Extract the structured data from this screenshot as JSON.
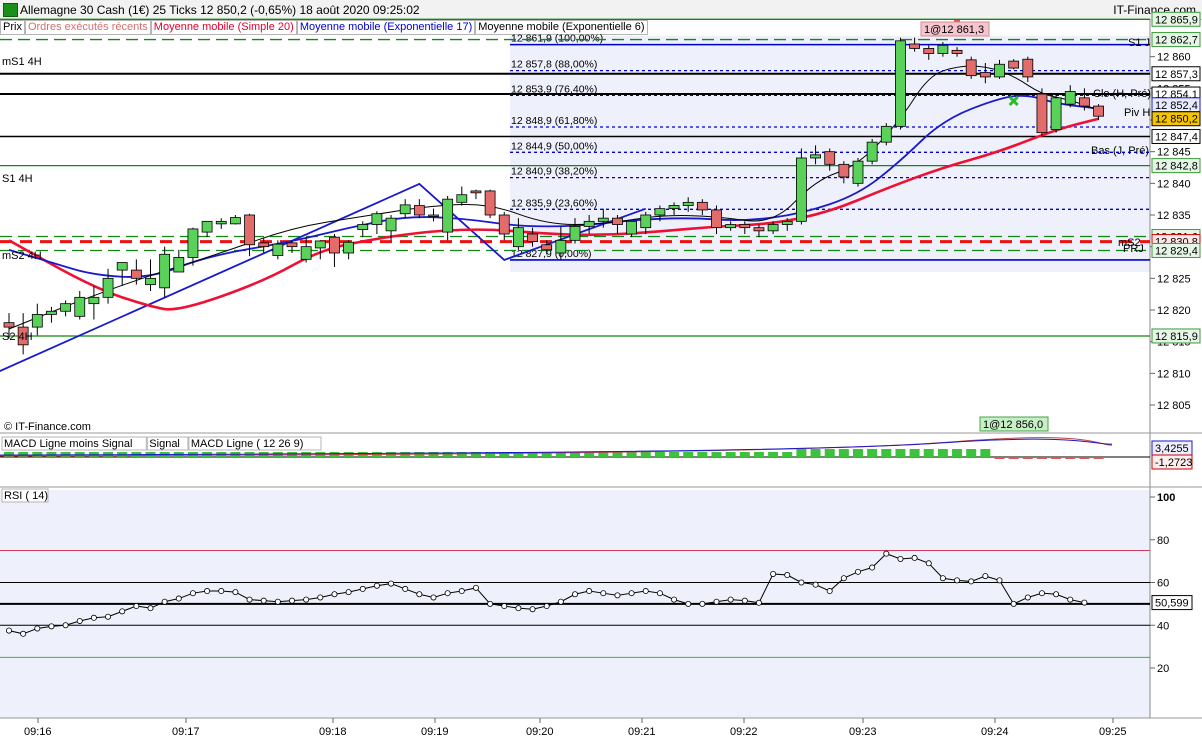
{
  "header": {
    "title": "Allemagne 30 Cash (1€)   25 Ticks   12 850,2 (-0,65%)   18 août 2020 09:25:02",
    "brand": "IT-Finance.com"
  },
  "legend": {
    "prix": "Prix",
    "ordres": "Ordres exécutés récents",
    "sma20": "Moyenne mobile (Simple 20)",
    "ema17": "Moyenne mobile (Exponentielle 17)",
    "ema6": "Moyenne mobile (Exponentielle 6)"
  },
  "watermark": "© IT-Finance.com",
  "colors": {
    "up": "#5ad25a",
    "down": "#e26b6b",
    "sma20": "#ee1133",
    "ema17": "#1a1acc",
    "ema6": "#000000",
    "pivot_green": "#118811",
    "fib_blue": "#0000cc",
    "macd_hist": "#3cc23c",
    "rsi_line": "#000000"
  },
  "chart_data": [
    {
      "type": "candlestick",
      "panel": "price",
      "ylim": [
        12799,
        12871
      ],
      "yticks": [
        12805,
        12810,
        12815,
        12820,
        12825,
        12830,
        12835,
        12840,
        12845,
        12850,
        12855,
        12860
      ],
      "xlabels": [
        "09:16",
        "09:17",
        "09:18",
        "09:19",
        "09:20",
        "09:21",
        "09:22",
        "09:23",
        "09:24",
        "09:25"
      ],
      "candles": [
        [
          12818.0,
          12819.5,
          12815.5,
          12817.3
        ],
        [
          12817.3,
          12819.5,
          12813.0,
          12814.5
        ],
        [
          12817.3,
          12821.0,
          12816.0,
          12819.3
        ],
        [
          12819.3,
          12820.5,
          12818.0,
          12819.8
        ],
        [
          12819.8,
          12821.5,
          12819.0,
          12821.0
        ],
        [
          12819.0,
          12823.0,
          12818.5,
          12822.0
        ],
        [
          12821.0,
          12823.8,
          12818.5,
          12822.0
        ],
        [
          12822.0,
          12826.5,
          12821.0,
          12825.0
        ],
        [
          12826.3,
          12827.0,
          12823.8,
          12827.5
        ],
        [
          12826.3,
          12828.0,
          12824.0,
          12825.0
        ],
        [
          12824.0,
          12828.0,
          12823.0,
          12825.0
        ],
        [
          12823.5,
          12830.0,
          12822.0,
          12828.8
        ],
        [
          12826.0,
          12829.5,
          12826.0,
          12828.3
        ],
        [
          12828.3,
          12833.0,
          12827.0,
          12832.8
        ],
        [
          12832.3,
          12834.0,
          12831.5,
          12834.0
        ],
        [
          12833.6,
          12834.5,
          12832.8,
          12834.0
        ],
        [
          12833.6,
          12835.0,
          12833.5,
          12834.6
        ],
        [
          12835.0,
          12835.2,
          12828.5,
          12830.3
        ],
        [
          12830.6,
          12831.3,
          12829.0,
          12830.0
        ],
        [
          12828.6,
          12831.0,
          12828.0,
          12830.4
        ],
        [
          12830.6,
          12831.0,
          12829.0,
          12830.0
        ],
        [
          12828.0,
          12831.5,
          12827.5,
          12830.0
        ],
        [
          12829.8,
          12831.0,
          12828.0,
          12830.9
        ],
        [
          12831.5,
          12832.0,
          12826.8,
          12829.0
        ],
        [
          12829.0,
          12831.0,
          12828.0,
          12830.7
        ],
        [
          12832.7,
          12834.0,
          12831.5,
          12833.5
        ],
        [
          12833.5,
          12835.6,
          12832.0,
          12835.2
        ],
        [
          12832.5,
          12835.0,
          12831.0,
          12834.5
        ],
        [
          12835.2,
          12837.5,
          12834.5,
          12836.6
        ],
        [
          12836.5,
          12837.5,
          12834.5,
          12835.0
        ],
        [
          12835.0,
          12836.0,
          12834.0,
          12835.0
        ],
        [
          12832.3,
          12838.0,
          12831.0,
          12837.5
        ],
        [
          12837.0,
          12839.5,
          12836.5,
          12838.2
        ],
        [
          12838.8,
          12839.0,
          12837.5,
          12838.5
        ],
        [
          12838.8,
          12839.0,
          12834.5,
          12835.0
        ],
        [
          12835.0,
          12835.5,
          12831.0,
          12832.0
        ],
        [
          12830.0,
          12834.5,
          12829.5,
          12833.0
        ],
        [
          12832.0,
          12833.0,
          12830.0,
          12830.8
        ],
        [
          12830.3,
          12831.0,
          12828.8,
          12829.5
        ],
        [
          12829.0,
          12833.2,
          12828.0,
          12831.0
        ],
        [
          12831.0,
          12834.5,
          12830.5,
          12833.2
        ],
        [
          12833.2,
          12835.0,
          12832.0,
          12834.0
        ],
        [
          12834.0,
          12836.0,
          12833.0,
          12834.5
        ],
        [
          12834.5,
          12835.0,
          12832.0,
          12833.5
        ],
        [
          12832.0,
          12834.0,
          12831.5,
          12834.0
        ],
        [
          12833.0,
          12835.5,
          12832.0,
          12835.0
        ],
        [
          12835.0,
          12836.5,
          12834.0,
          12836.0
        ],
        [
          12836.0,
          12837.0,
          12835.0,
          12836.5
        ],
        [
          12836.5,
          12837.8,
          12835.5,
          12837.0
        ],
        [
          12837.0,
          12837.5,
          12835.0,
          12835.8
        ],
        [
          12835.8,
          12836.5,
          12832.0,
          12833.0
        ],
        [
          12833.0,
          12834.0,
          12832.5,
          12833.5
        ],
        [
          12833.5,
          12834.0,
          12832.0,
          12833.0
        ],
        [
          12833.0,
          12833.5,
          12831.5,
          12832.5
        ],
        [
          12832.5,
          12834.0,
          12832.0,
          12833.5
        ],
        [
          12833.5,
          12834.5,
          12832.5,
          12834.0
        ],
        [
          12834.0,
          12845.5,
          12833.5,
          12844.0
        ],
        [
          12844.0,
          12846.0,
          12843.0,
          12844.5
        ],
        [
          12845.0,
          12845.5,
          12842.0,
          12843.0
        ],
        [
          12843.0,
          12843.5,
          12840.0,
          12841.0
        ],
        [
          12840.0,
          12844.0,
          12839.5,
          12843.5
        ],
        [
          12843.5,
          12847.0,
          12843.0,
          12846.5
        ],
        [
          12846.5,
          12849.5,
          12846.0,
          12849.0
        ],
        [
          12849.0,
          12863.0,
          12848.5,
          12862.5
        ],
        [
          12862.0,
          12863.0,
          12860.8,
          12861.3
        ],
        [
          12861.3,
          12861.8,
          12859.5,
          12860.5
        ],
        [
          12860.5,
          12862.3,
          12860.0,
          12861.8
        ],
        [
          12861.0,
          12861.5,
          12860.0,
          12860.5
        ],
        [
          12859.5,
          12860.0,
          12856.5,
          12857.0
        ],
        [
          12857.5,
          12859.0,
          12855.8,
          12856.8
        ],
        [
          12856.8,
          12859.5,
          12856.5,
          12858.8
        ],
        [
          12859.3,
          12859.6,
          12858.0,
          12858.2
        ],
        [
          12859.6,
          12860.0,
          12856.0,
          12856.8
        ],
        [
          12854.1,
          12855.0,
          12847.5,
          12848.0
        ],
        [
          12848.5,
          12854.0,
          12848.0,
          12853.5
        ],
        [
          12852.5,
          12855.5,
          12852.0,
          12854.5
        ],
        [
          12853.5,
          12855.0,
          12851.5,
          12852.2
        ],
        [
          12852.2,
          12852.5,
          12850.0,
          12850.6
        ]
      ],
      "sma20": [
        [
          0,
          12831.0
        ],
        [
          6,
          12823.5
        ],
        [
          10,
          12820.5
        ],
        [
          12,
          12819.8
        ],
        [
          18,
          12824.5
        ],
        [
          22,
          12829.5
        ],
        [
          26,
          12831.3
        ],
        [
          30,
          12832.5
        ],
        [
          34,
          12832.8
        ],
        [
          38,
          12832.0
        ],
        [
          42,
          12831.8
        ],
        [
          46,
          12832.4
        ],
        [
          50,
          12833.2
        ],
        [
          54,
          12833.6
        ],
        [
          58,
          12835.5
        ],
        [
          62,
          12839.2
        ],
        [
          66,
          12842.5
        ],
        [
          70,
          12845.0
        ],
        [
          74,
          12848.5
        ],
        [
          77,
          12850.2
        ]
      ],
      "ema17": [
        [
          0,
          12829.5
        ],
        [
          3,
          12827.5
        ],
        [
          6,
          12825.5
        ],
        [
          10,
          12825.0
        ],
        [
          14,
          12828.5
        ],
        [
          20,
          12830.8
        ],
        [
          24,
          12833.0
        ],
        [
          28,
          12834.8
        ],
        [
          32,
          12834.5
        ],
        [
          36,
          12833.2
        ],
        [
          40,
          12833.2
        ],
        [
          44,
          12834.2
        ],
        [
          48,
          12834.6
        ],
        [
          52,
          12834.0
        ],
        [
          56,
          12835.2
        ],
        [
          60,
          12838.2
        ],
        [
          63,
          12843.5
        ],
        [
          66,
          12850.0
        ],
        [
          70,
          12853.5
        ],
        [
          72,
          12854.0
        ],
        [
          74,
          12852.6
        ],
        [
          77,
          12851.8
        ]
      ],
      "ema6": [
        [
          0,
          12817.0
        ],
        [
          5,
          12821.5
        ],
        [
          10,
          12825.5
        ],
        [
          15,
          12829.0
        ],
        [
          20,
          12833.0
        ],
        [
          25,
          12834.8
        ],
        [
          30,
          12836.5
        ],
        [
          34,
          12836.8
        ],
        [
          38,
          12833.5
        ],
        [
          42,
          12833.5
        ],
        [
          46,
          12835.0
        ],
        [
          50,
          12834.8
        ],
        [
          54,
          12833.5
        ],
        [
          57,
          12840.5
        ],
        [
          60,
          12842.8
        ],
        [
          63,
          12850.0
        ],
        [
          65,
          12857.0
        ],
        [
          67,
          12858.5
        ],
        [
          69,
          12858.5
        ],
        [
          71,
          12857.0
        ],
        [
          73,
          12854.0
        ],
        [
          75,
          12853.2
        ],
        [
          77,
          12851.5
        ]
      ],
      "zigzag": [
        [
          -1,
          12810.0
        ],
        [
          29,
          12839.9
        ],
        [
          35,
          12827.9
        ],
        [
          45,
          12836.0
        ]
      ],
      "fib_levels": [
        {
          "label": "12 861,9 (100,00%)",
          "value": 12861.9
        },
        {
          "label": "12 857,8 (88,00%)",
          "value": 12857.8
        },
        {
          "label": "12 853,9 (76,40%)",
          "value": 12853.9
        },
        {
          "label": "12 848,9 (61,80%)",
          "value": 12848.9
        },
        {
          "label": "12 844,9 (50,00%)",
          "value": 12844.9
        },
        {
          "label": "12 840,9 (38,20%)",
          "value": 12840.9
        },
        {
          "label": "12 835,9 (23,60%)",
          "value": 12835.9
        },
        {
          "label": "12 827,9 (0,00%)",
          "value": 12827.9
        }
      ],
      "fib_top_dotted": 12869.6,
      "price_labels": [
        {
          "value": 12865.9,
          "label": "12 865,9",
          "kind": "green"
        },
        {
          "value": 12862.7,
          "label": "12 862,7",
          "kind": "green"
        },
        {
          "value": 12857.3,
          "label": "12 857,3",
          "kind": "black"
        },
        {
          "value": 12854.1,
          "label": "12 854,1",
          "kind": "black"
        },
        {
          "value": 12852.4,
          "label": "12 852,4",
          "kind": "blue"
        },
        {
          "value": 12850.2,
          "label": "12 850,2",
          "kind": "current"
        },
        {
          "value": 12847.4,
          "label": "12 847,4",
          "kind": "black"
        },
        {
          "value": 12842.8,
          "label": "12 842,8",
          "kind": "green"
        },
        {
          "value": 12831.6,
          "label": "12 831,6",
          "kind": "green"
        },
        {
          "value": 12830.8,
          "label": "12 830,8",
          "kind": "red"
        },
        {
          "value": 12829.4,
          "label": "12 829,4",
          "kind": "green"
        },
        {
          "value": 12815.9,
          "label": "12 815,9",
          "kind": "green"
        }
      ],
      "annotations": {
        "s1j": "S1 J",
        "ms1_4h": "mS1 4H",
        "s1_4h": "S1 4H",
        "ms2_4h": "mS2 4H",
        "s2_4h": "S2 4H",
        "clo": "Clo (H, Pré)",
        "piv": "Piv H",
        "bas": "Bas (J, Pré)",
        "ms2": "mS2",
        "prj": "PRJ",
        "top_box": "1@12 861,3",
        "bottom_box": "1@12 856,0"
      }
    },
    {
      "type": "bar",
      "panel": "macd",
      "legend": [
        "MACD Ligne moins Signal",
        "Signal",
        "MACD Ligne ( 12 26 9)"
      ],
      "value_labels": [
        "3,4255",
        "-1,2723"
      ],
      "histogram_sign": "positive from 09:16 to 09:24, then slightly negative"
    },
    {
      "type": "line",
      "panel": "rsi",
      "title": "RSI ( 14)",
      "ylim": [
        0,
        100
      ],
      "yticks": [
        20,
        40,
        60,
        80,
        100
      ],
      "levels": [
        {
          "value": 75,
          "color": "#cc2244"
        },
        {
          "value": 60,
          "color": "#000000"
        },
        {
          "value": 40,
          "color": "#000000"
        },
        {
          "value": 25,
          "color": "#22aa22"
        },
        {
          "value": 50,
          "color": "#000000"
        }
      ],
      "current_label": "50,599",
      "values": [
        37.5,
        36.0,
        38.5,
        39.5,
        40.0,
        42.0,
        43.5,
        44.0,
        46.5,
        49.0,
        48.0,
        51.0,
        52.5,
        55.0,
        56.0,
        56.0,
        55.5,
        52.0,
        51.5,
        51.0,
        51.5,
        52.0,
        53.0,
        54.5,
        55.5,
        57.0,
        58.5,
        59.5,
        57.0,
        54.5,
        53.0,
        55.0,
        56.0,
        57.5,
        50.0,
        49.0,
        48.0,
        47.5,
        49.0,
        51.0,
        54.5,
        56.0,
        55.0,
        54.0,
        55.0,
        56.0,
        55.0,
        52.0,
        50.0,
        50.0,
        51.0,
        52.0,
        51.5,
        50.5,
        64.0,
        63.5,
        60.0,
        59.0,
        56.0,
        62.0,
        65.0,
        67.0,
        73.5,
        71.0,
        71.5,
        69.0,
        62.0,
        61.0,
        60.5,
        63.0,
        61.0,
        50.0,
        53.0,
        55.0,
        54.5,
        52.0,
        50.6
      ]
    }
  ]
}
